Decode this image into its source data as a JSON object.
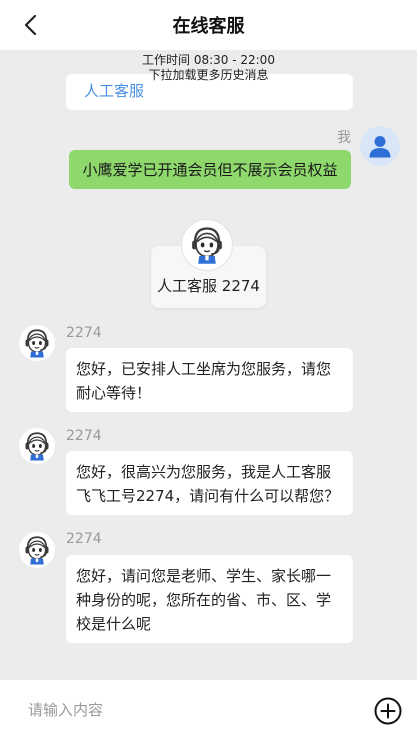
{
  "header": {
    "title": "在线客服"
  },
  "chat": {
    "work_hours": "工作时间 08:30 - 22:00",
    "load_more": "下拉加载更多历史消息",
    "previous_link": "人工客服",
    "me": {
      "label": "我",
      "message": "小鹰爱学已开通会员但不展示会员权益"
    },
    "agent_card": {
      "label": "人工客服 2274"
    },
    "agent_messages": [
      {
        "name": "2274",
        "text": "您好，已安排人工坐席为您服务，请您耐心等待！"
      },
      {
        "name": "2274",
        "text": "您好，很高兴为您服务，我是人工客服飞飞工号2274，请问有什么可以帮您？"
      },
      {
        "name": "2274",
        "text": "您好，请问您是老师、学生、家长哪一种身份的呢，您所在的省、市、区、学校是什么呢"
      }
    ]
  },
  "footer": {
    "input_placeholder": "请输入内容",
    "input_value": ""
  },
  "icons": {
    "back": "chevron-left-icon",
    "user": "user-icon",
    "agent": "support-agent-avatar",
    "add": "plus-circle-icon"
  },
  "colors": {
    "my_bubble": "#8fd96c",
    "link": "#4a90e2",
    "agent_blue": "#2f6fd6",
    "user_icon": "#2f6fd6"
  }
}
